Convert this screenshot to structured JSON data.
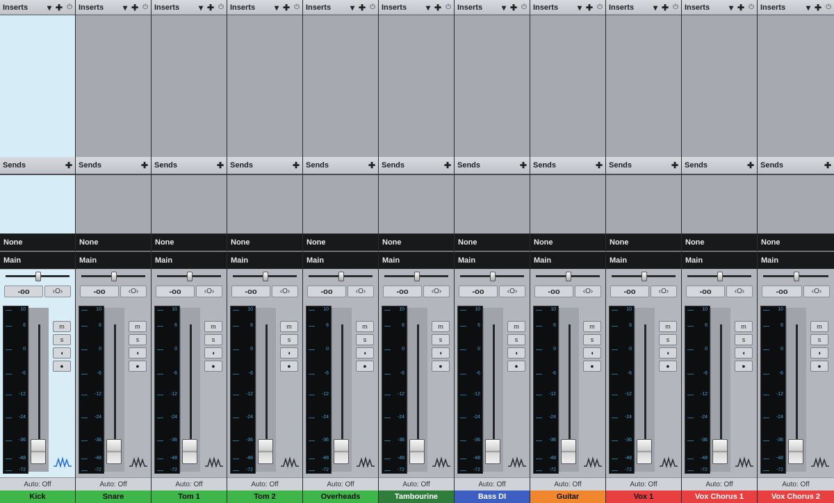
{
  "labels": {
    "inserts": "Inserts",
    "sends": "Sends",
    "route_none": "None",
    "route_main": "Main",
    "pan_value": "-oo",
    "link_icon": "‹O›",
    "mute": "m",
    "solo": "s",
    "monitor": "◖",
    "record": "●",
    "automation": "Auto: Off"
  },
  "icons": {
    "dropdown": "chevron-down-icon",
    "add": "plus-icon",
    "power": "power-icon",
    "waveform": "waveform-icon"
  },
  "meter_scale": [
    "10",
    "6",
    "0",
    "-6",
    "-12",
    "-24",
    "-36",
    "-48",
    "-72"
  ],
  "channels": [
    {
      "name": "Kick",
      "color": "#3fb64a",
      "text_color": "#111111",
      "selected": true,
      "pan": 0.5
    },
    {
      "name": "Snare",
      "color": "#3fb64a",
      "text_color": "#111111",
      "selected": false,
      "pan": 0.5
    },
    {
      "name": "Tom 1",
      "color": "#3fb64a",
      "text_color": "#111111",
      "selected": false,
      "pan": 0.5
    },
    {
      "name": "Tom 2",
      "color": "#3fb64a",
      "text_color": "#111111",
      "selected": false,
      "pan": 0.5
    },
    {
      "name": "Overheads",
      "color": "#3fb64a",
      "text_color": "#111111",
      "selected": false,
      "pan": 0.5
    },
    {
      "name": "Tambourine",
      "color": "#2f7d3a",
      "text_color": "#ffffff",
      "selected": false,
      "pan": 0.5
    },
    {
      "name": "Bass DI",
      "color": "#3d5fc2",
      "text_color": "#ffffff",
      "selected": false,
      "pan": 0.5
    },
    {
      "name": "Guitar",
      "color": "#f0862d",
      "text_color": "#111111",
      "selected": false,
      "pan": 0.5
    },
    {
      "name": "Vox 1",
      "color": "#e84040",
      "text_color": "#111111",
      "selected": false,
      "pan": 0.5
    },
    {
      "name": "Vox Chorus 1",
      "color": "#e84040",
      "text_color": "#ffffff",
      "selected": false,
      "pan": 0.5
    },
    {
      "name": "Vox Chorus 2",
      "color": "#e84040",
      "text_color": "#ffffff",
      "selected": false,
      "pan": 0.5
    }
  ]
}
